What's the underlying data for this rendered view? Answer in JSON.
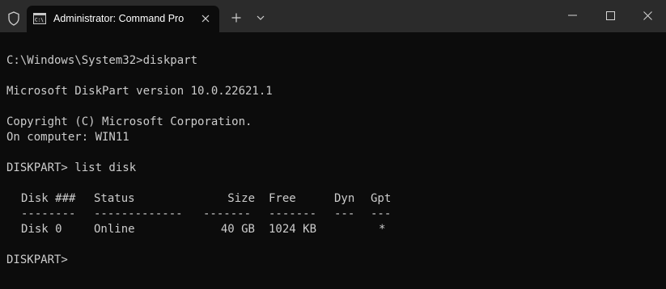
{
  "titlebar": {
    "tab_title": "Administrator: Command Pro",
    "icons": {
      "shield": "shield-icon",
      "tab": "command-prompt-icon",
      "close_tab": "close-icon",
      "new_tab": "plus-icon",
      "dropdown": "chevron-down-icon",
      "minimize": "minimize-icon",
      "maximize": "maximize-icon",
      "close_window": "close-icon"
    }
  },
  "console": {
    "lines": [
      "C:\\Windows\\System32>diskpart",
      "",
      "Microsoft DiskPart version 10.0.22621.1",
      "",
      "Copyright (C) Microsoft Corporation.",
      "On computer: WIN11",
      "",
      "DISKPART> list disk",
      ""
    ],
    "table": {
      "headers": {
        "disk": "Disk ###",
        "status": "Status",
        "size": "Size",
        "free": "Free",
        "dyn": "Dyn",
        "gpt": "Gpt"
      },
      "separators": {
        "disk": "--------",
        "status": "-------------",
        "size": "-------",
        "free": "-------",
        "dyn": "---",
        "gpt": "---"
      },
      "rows": [
        {
          "disk": "Disk 0",
          "status": "Online",
          "size": "40 GB",
          "free": "1024 KB",
          "dyn": "",
          "gpt": "*"
        }
      ]
    },
    "prompt": "DISKPART>"
  },
  "colors": {
    "background": "#0c0c0c",
    "titlebar": "#2b2b2b",
    "text": "#cccccc"
  }
}
